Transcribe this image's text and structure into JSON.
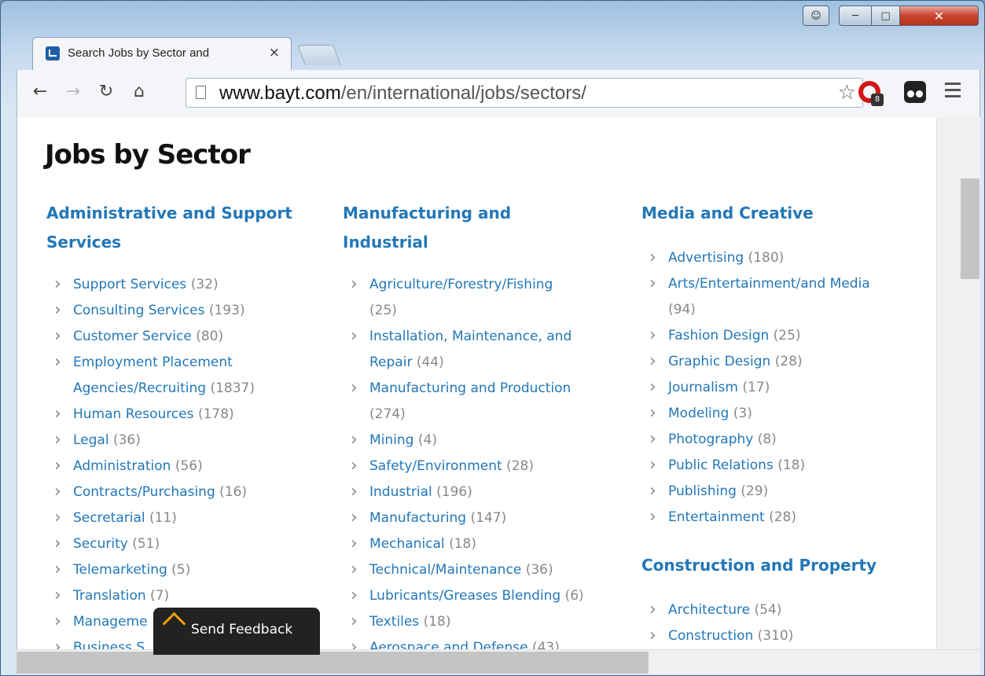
{
  "browser": {
    "tab_title": "Search Jobs by Sector and",
    "tab_close": "×",
    "url_host": "www.bayt.com",
    "url_path": "/en/international/jobs/sectors/",
    "opera_badge": "8"
  },
  "page": {
    "title": "Jobs by Sector",
    "columns": [
      {
        "sections": [
          {
            "heading_line1": "Administrative and Support",
            "heading_line2": "Services",
            "items": [
              {
                "label": "Support Services",
                "count": "(32)"
              },
              {
                "label": "Consulting Services",
                "count": "(193)"
              },
              {
                "label": "Customer Service",
                "count": "(80)"
              },
              {
                "label": "Employment Placement",
                "label2": "Agencies/Recruiting",
                "count": "(1837)"
              },
              {
                "label": "Human Resources",
                "count": "(178)"
              },
              {
                "label": "Legal",
                "count": "(36)"
              },
              {
                "label": "Administration",
                "count": "(56)"
              },
              {
                "label": "Contracts/Purchasing",
                "count": "(16)"
              },
              {
                "label": "Secretarial",
                "count": "(11)"
              },
              {
                "label": "Security",
                "count": "(51)"
              },
              {
                "label": "Telemarketing",
                "count": "(5)"
              },
              {
                "label": "Translation",
                "count": "(7)"
              },
              {
                "label": "Manageme",
                "count": ""
              },
              {
                "label": "Business S",
                "count": ""
              }
            ]
          }
        ]
      },
      {
        "sections": [
          {
            "heading_line1": "Manufacturing and",
            "heading_line2": "Industrial",
            "items": [
              {
                "label": "Agriculture/Forestry/Fishing",
                "count": "(25)"
              },
              {
                "label": "Installation, Maintenance, and",
                "label2": "Repair",
                "count": "(44)"
              },
              {
                "label": "Manufacturing and Production",
                "count": "(274)"
              },
              {
                "label": "Mining",
                "count": "(4)"
              },
              {
                "label": "Safety/Environment",
                "count": "(28)"
              },
              {
                "label": "Industrial",
                "count": "(196)"
              },
              {
                "label": "Manufacturing",
                "count": "(147)"
              },
              {
                "label": "Mechanical",
                "count": "(18)"
              },
              {
                "label": "Technical/Maintenance",
                "count": "(36)"
              },
              {
                "label": "Lubricants/Greases Blending",
                "count": "(6)"
              },
              {
                "label": "Textiles",
                "count": "(18)"
              },
              {
                "label": "Aerospace and Defense",
                "count": "(43)"
              }
            ]
          }
        ]
      },
      {
        "sections": [
          {
            "heading_line1": "Media and Creative",
            "items": [
              {
                "label": "Advertising",
                "count": "(180)"
              },
              {
                "label": "Arts/Entertainment/and Media",
                "count": "(94)"
              },
              {
                "label": "Fashion Design",
                "count": "(25)"
              },
              {
                "label": "Graphic Design",
                "count": "(28)"
              },
              {
                "label": "Journalism",
                "count": "(17)"
              },
              {
                "label": "Modeling",
                "count": "(3)"
              },
              {
                "label": "Photography",
                "count": "(8)"
              },
              {
                "label": "Public Relations",
                "count": "(18)"
              },
              {
                "label": "Publishing",
                "count": "(29)"
              },
              {
                "label": "Entertainment",
                "count": "(28)"
              }
            ]
          },
          {
            "heading_line1": "Construction and Property",
            "items": [
              {
                "label": "Architecture",
                "count": "(54)"
              },
              {
                "label": "Construction",
                "count": "(310)"
              }
            ]
          }
        ]
      }
    ]
  },
  "feedback": {
    "label": "Send Feedback"
  }
}
